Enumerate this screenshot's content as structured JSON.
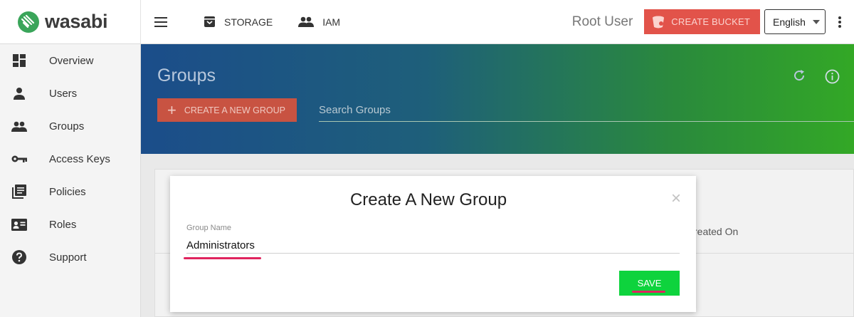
{
  "header": {
    "logo_text": "wasabi",
    "nav": [
      {
        "label": "STORAGE",
        "icon": "storage-icon"
      },
      {
        "label": "IAM",
        "icon": "people-icon"
      }
    ],
    "user_label": "Root User",
    "create_bucket_label": "CREATE BUCKET",
    "language": "English"
  },
  "sidebar": {
    "items": [
      {
        "label": "Overview",
        "icon": "dashboard-icon"
      },
      {
        "label": "Users",
        "icon": "person-icon"
      },
      {
        "label": "Groups",
        "icon": "group-icon"
      },
      {
        "label": "Access Keys",
        "icon": "key-icon"
      },
      {
        "label": "Policies",
        "icon": "library-icon"
      },
      {
        "label": "Roles",
        "icon": "id-card-icon"
      },
      {
        "label": "Support",
        "icon": "help-icon"
      }
    ]
  },
  "page": {
    "title": "Groups",
    "create_group_label": "CREATE A NEW GROUP",
    "search_placeholder": "Search Groups",
    "table_column_partial": "reated On"
  },
  "modal": {
    "title": "Create A New Group",
    "close_glyph": "×",
    "field_label": "Group Name",
    "field_value": "Administrators",
    "save_label": "SAVE"
  },
  "colors": {
    "accent_red": "#e2534a",
    "save_green": "#0ed33d",
    "annotation_pink": "#e0245e"
  }
}
